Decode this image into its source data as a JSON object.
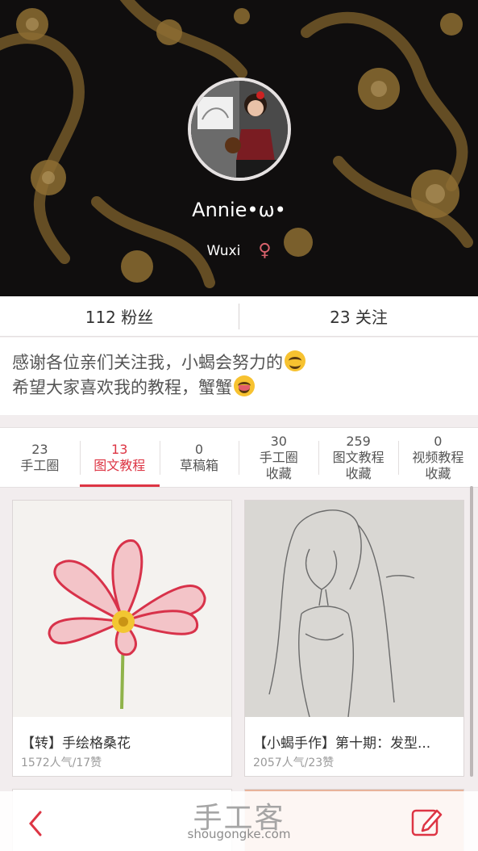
{
  "profile": {
    "username": "Annie•ω•",
    "location": "Wuxi",
    "gender_icon": "female-icon"
  },
  "stats": {
    "followers": "112 粉丝",
    "following": "23 关注"
  },
  "bio": {
    "line1": "感谢各位亲们关注我，小蝎会努力的",
    "line2": "希望大家喜欢我的教程，蟹蟹"
  },
  "tabs": [
    {
      "count": "23",
      "label": "手工圈",
      "active": false
    },
    {
      "count": "13",
      "label": "图文教程",
      "active": true
    },
    {
      "count": "0",
      "label": "草稿箱",
      "active": false
    },
    {
      "count": "30",
      "label": "手工圈\n收藏",
      "active": false
    },
    {
      "count": "259",
      "label": "图文教程\n收藏",
      "active": false
    },
    {
      "count": "0",
      "label": "视频教程\n收藏",
      "active": false
    }
  ],
  "cards": [
    {
      "title": "【转】手绘格桑花",
      "meta": "1572人气/17赞"
    },
    {
      "title": "【小蝎手作】第十期：发型...",
      "meta": "2057人气/23赞"
    }
  ],
  "watermark": {
    "main": "手工客",
    "sub": "shougongke.com"
  },
  "colors": {
    "accent": "#dd3544",
    "gender": "#d8626c"
  }
}
